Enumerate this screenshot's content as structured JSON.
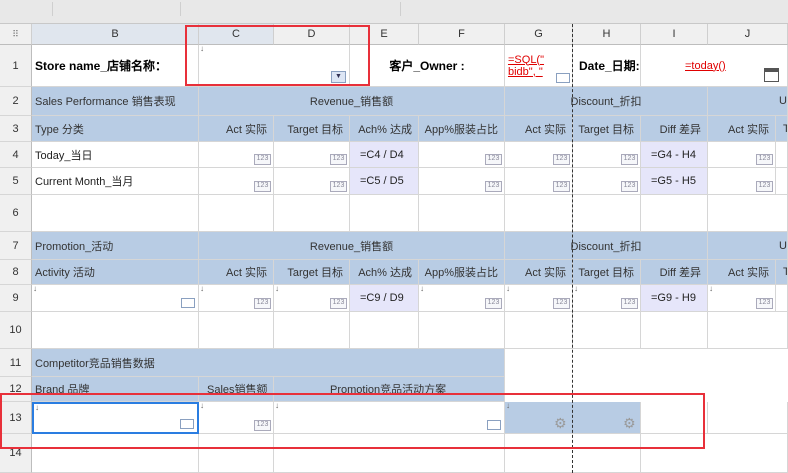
{
  "columns": {
    "corner": "⠿",
    "B": "B",
    "C": "C",
    "D": "D",
    "E": "E",
    "F": "F",
    "G": "G",
    "H": "H",
    "I": "I",
    "J": "J"
  },
  "rows": {
    "r1": "1",
    "r2": "2",
    "r3": "3",
    "r4": "4",
    "r5": "5",
    "r6": "6",
    "r7": "7",
    "r8": "8",
    "r9": "9",
    "r10": "10",
    "r11": "11",
    "r12": "12",
    "r13": "13",
    "r14": "14"
  },
  "header": {
    "store_label": "Store name_店铺名称：",
    "owner_label": "客户_Owner :",
    "sql_formula_line1": "=SQL(\"",
    "sql_formula_line2": "bidb\", \"",
    "date_label": "Date_日期:",
    "today_formula": "=today()"
  },
  "sales": {
    "title": "Sales Performance 销售表现",
    "revenue": "Revenue_销售额",
    "discount": "Discount_折扣",
    "cut_u": "U",
    "type": "Type 分类",
    "act": "Act 实际",
    "target": "Target 目标",
    "ach": "Ach% 达成",
    "app": "App%服装占比",
    "act2": "Act 实际",
    "target2": "Target 目标",
    "diff": "Diff 差异",
    "act3": "Act 实际",
    "cut_t": "T",
    "today": "Today_当日",
    "month": "Current Month_当月",
    "f_c4d4": "=C4 / D4",
    "f_c5d5": "=C5 / D5",
    "f_g4h4": "=G4 - H4",
    "f_g5h5": "=G5 - H5"
  },
  "promotion": {
    "title": "Promotion_活动",
    "revenue": "Revenue_销售额",
    "discount": "Discount_折扣",
    "cut_u": "U",
    "activity": "Activity 活动",
    "act": "Act 实际",
    "target": "Target 目标",
    "ach": "Ach% 达成",
    "app": "App%服装占比",
    "act2": "Act 实际",
    "target2": "Target 目标",
    "diff": "Diff 差异",
    "act3": "Act 实际",
    "cut_t": "T",
    "f_c9d9": "=C9 / D9",
    "f_g9h9": "=G9 - H9"
  },
  "competitor": {
    "title": "Competitor竞品销售数据",
    "brand": "Brand 品牌",
    "sales": "Sales销售额",
    "promo": "Promotion竞品活动方案"
  },
  "badge": "123",
  "colors": {
    "header_blue": "#b8cce4",
    "formula_bg": "#e6e6fa",
    "highlight_red": "#e8303a",
    "select_blue": "#2a7de1"
  }
}
